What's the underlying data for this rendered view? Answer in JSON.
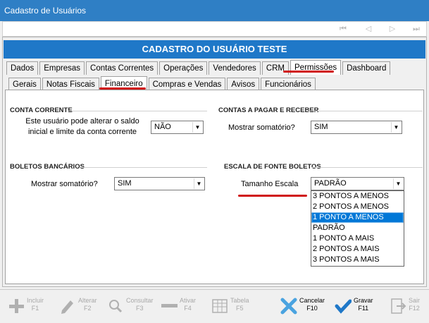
{
  "window": {
    "title": "Cadastro de Usuários"
  },
  "header": {
    "title": "CADASTRO DO USUÁRIO TESTE"
  },
  "nav_buttons": [
    "first",
    "previous",
    "next",
    "last"
  ],
  "main_tabs": [
    {
      "label": "Dados"
    },
    {
      "label": "Empresas"
    },
    {
      "label": "Contas Correntes"
    },
    {
      "label": "Operações"
    },
    {
      "label": "Vendedores"
    },
    {
      "label": "CRM"
    },
    {
      "label": "Permissões",
      "active": true
    },
    {
      "label": "Dashboard"
    }
  ],
  "sub_tabs": [
    {
      "label": "Gerais"
    },
    {
      "label": "Notas Fiscais"
    },
    {
      "label": "Financeiro",
      "active": true
    },
    {
      "label": "Compras e Vendas"
    },
    {
      "label": "Avisos"
    },
    {
      "label": "Funcionários"
    }
  ],
  "conta_corrente": {
    "title": "CONTA CORRENTE",
    "label_line1": "Este usuário pode alterar o saldo",
    "label_line2": "inicial e limite da conta corrente",
    "value": "NÃO"
  },
  "contas_pagar": {
    "title": "CONTAS A PAGAR E RECEBER",
    "label": "Mostrar somatório?",
    "value": "SIM"
  },
  "boletos": {
    "title": "BOLETOS BANCÁRIOS",
    "label": "Mostrar somatório?",
    "value": "SIM"
  },
  "escala": {
    "title": "ESCALA DE FONTE BOLETOS",
    "label": "Tamanho Escala",
    "value": "PADRÃO",
    "options": [
      "3 PONTOS A MENOS",
      "2 PONTOS A MENOS",
      "1 PONTO A MENOS",
      "PADRÃO",
      "1 PONTO A MAIS",
      "2 PONTOS A MAIS",
      "3 PONTOS A MAIS"
    ],
    "highlighted": "1 PONTO A MENOS"
  },
  "toolbar": {
    "incluir": {
      "label": "Incluir",
      "key": "F1"
    },
    "alterar": {
      "label": "Alterar",
      "key": "F2"
    },
    "consultar": {
      "label": "Consultar",
      "key": "F3"
    },
    "ativar": {
      "label": "Ativar",
      "key": "F4"
    },
    "tabela": {
      "label": "Tabela",
      "key": "F5"
    },
    "cancelar": {
      "label": "Cancelar",
      "key": "F10"
    },
    "gravar": {
      "label": "Gravar",
      "key": "F11"
    },
    "sair": {
      "label": "Sair",
      "key": "F12"
    }
  },
  "colors": {
    "title_bar": "#2f7fc5",
    "header": "#1f78c8",
    "highlight": "#0078d7",
    "underline": "#d01414"
  }
}
